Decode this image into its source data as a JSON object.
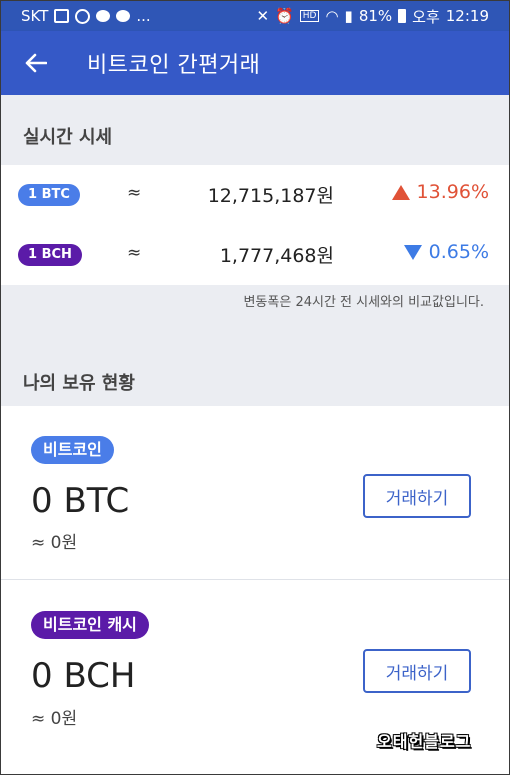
{
  "status_bar": {
    "carrier": "SKT",
    "more": "...",
    "battery": "81%",
    "period": "오후",
    "time": "12:19"
  },
  "header": {
    "title": "비트코인 간편거래"
  },
  "realtime": {
    "section_title": "실시간 시세",
    "rows": [
      {
        "ticker": "1 BTC",
        "approx": "≈",
        "price": "12,715,187원",
        "change": "13.96%",
        "direction": "up",
        "pill_color": "#4a7de8",
        "change_color": "#e05237"
      },
      {
        "ticker": "1 BCH",
        "approx": "≈",
        "price": "1,777,468원",
        "change": "0.65%",
        "direction": "down",
        "pill_color": "#5b1ba8",
        "change_color": "#3d7be5"
      }
    ],
    "note": "변동폭은 24시간 전 시세와의 비교값입니다."
  },
  "holdings": {
    "section_title": "나의 보유 현황",
    "cards": [
      {
        "name": "비트코인",
        "amount": "0 BTC",
        "krw": "≈ 0원",
        "button": "거래하기",
        "badge_color": "#4a7de8"
      },
      {
        "name": "비트코인 캐시",
        "amount": "0 BCH",
        "krw": "≈ 0원",
        "button": "거래하기",
        "badge_color": "#5b1ba8"
      }
    ]
  },
  "watermark": "오태헌블로그"
}
